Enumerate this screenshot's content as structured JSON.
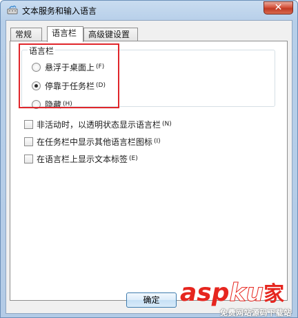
{
  "window": {
    "title": "文本服务和输入语言",
    "close_glyph": "✕"
  },
  "tabs": [
    {
      "label": "常规",
      "active": false
    },
    {
      "label": "语言栏",
      "active": true
    },
    {
      "label": "高级键设置",
      "active": false
    }
  ],
  "language_bar_group": {
    "title": "语言栏",
    "options": [
      {
        "label": "悬浮于桌面上",
        "mnemonic": "(F)",
        "checked": false
      },
      {
        "label": "停靠于任务栏",
        "mnemonic": "(D)",
        "checked": true
      },
      {
        "label": "隐藏",
        "mnemonic": "(H)",
        "checked": false
      }
    ]
  },
  "checkboxes": [
    {
      "label": "非活动时，以透明状态显示语言栏",
      "mnemonic": "(N)",
      "checked": false
    },
    {
      "label": "在任务栏中显示其他语言栏图标",
      "mnemonic": "(I)",
      "checked": false
    },
    {
      "label": "在语言栏上显示文本标签",
      "mnemonic": "(E)",
      "checked": false
    }
  ],
  "buttons": {
    "ok_label": "确定"
  },
  "watermark": {
    "asp": "asp",
    "ku": "ku",
    "jia": "家",
    "sub": "免费网站源码下载站"
  },
  "colors": {
    "highlight_box": "#e0252a",
    "watermark_red": "#e6261f"
  }
}
